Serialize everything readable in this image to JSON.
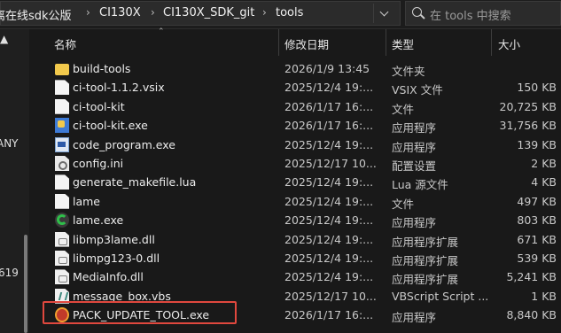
{
  "address": {
    "crumbs": [
      "离在线sdk公版",
      "CI130X",
      "CI130X_SDK_git",
      "tools"
    ],
    "separator": "›"
  },
  "search": {
    "placeholder": "在 tools 中搜索"
  },
  "left_pane": {
    "fragments": [
      "ANY",
      "619"
    ]
  },
  "columns": {
    "name": "名称",
    "date": "修改日期",
    "type": "类型",
    "size": "大小"
  },
  "files": [
    {
      "name": "build-tools",
      "date": "2026/1/9 13:45",
      "type": "文件夹",
      "size": "",
      "icon": "folder-icon"
    },
    {
      "name": "ci-tool-1.1.2.vsix",
      "date": "2025/12/4 19:...",
      "type": "VSIX 文件",
      "size": "150 KB",
      "icon": "document-icon"
    },
    {
      "name": "ci-tool-kit",
      "date": "2026/1/17 16:...",
      "type": "文件",
      "size": "20,725 KB",
      "icon": "document-icon"
    },
    {
      "name": "ci-tool-kit.exe",
      "date": "2026/1/17 16:...",
      "type": "应用程序",
      "size": "31,756 KB",
      "icon": "python-exe-icon"
    },
    {
      "name": "code_program.exe",
      "date": "2025/12/4 19:...",
      "type": "应用程序",
      "size": "139 KB",
      "icon": "program-exe-icon"
    },
    {
      "name": "config.ini",
      "date": "2025/12/17 10...",
      "type": "配置设置",
      "size": "2 KB",
      "icon": "settings-file-icon"
    },
    {
      "name": "generate_makefile.lua",
      "date": "2025/12/4 19:...",
      "type": "Lua 源文件",
      "size": "4 KB",
      "icon": "document-icon"
    },
    {
      "name": "lame",
      "date": "2025/12/4 19:...",
      "type": "文件",
      "size": "497 KB",
      "icon": "document-icon"
    },
    {
      "name": "lame.exe",
      "date": "2025/12/4 19:...",
      "type": "应用程序",
      "size": "803 KB",
      "icon": "lame-app-icon"
    },
    {
      "name": "libmp3lame.dll",
      "date": "2025/12/4 19:...",
      "type": "应用程序扩展",
      "size": "671 KB",
      "icon": "dll-icon"
    },
    {
      "name": "libmpg123-0.dll",
      "date": "2025/12/4 19:...",
      "type": "应用程序扩展",
      "size": "539 KB",
      "icon": "dll-icon"
    },
    {
      "name": "MediaInfo.dll",
      "date": "2025/12/4 19:...",
      "type": "应用程序扩展",
      "size": "5,241 KB",
      "icon": "dll-icon"
    },
    {
      "name": "message_box.vbs",
      "date": "2025/12/17 10...",
      "type": "VBScript Script ...",
      "size": "1 KB",
      "icon": "vbscript-icon"
    },
    {
      "name": "PACK_UPDATE_TOOL.exe",
      "date": "2026/1/17 16:...",
      "type": "应用程序",
      "size": "8,840 KB",
      "icon": "pack-tool-icon"
    }
  ],
  "colors": {
    "background": "#191919",
    "highlight": "#e0483e",
    "folder": "#f2c94c"
  }
}
